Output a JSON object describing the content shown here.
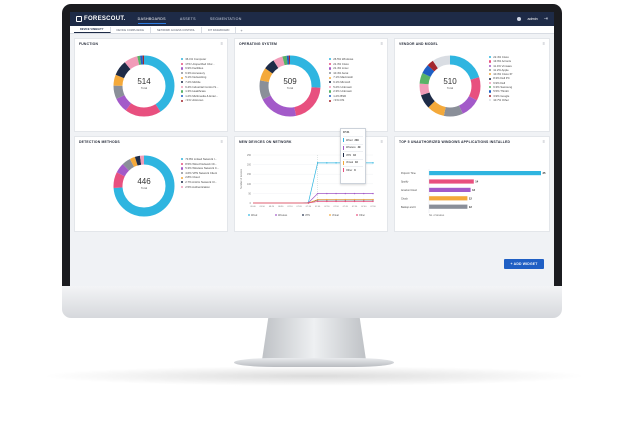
{
  "colors": {
    "cyan": "#2fb5e0",
    "pink": "#e8507f",
    "purple": "#a35ac9",
    "grey": "#8a8f99",
    "orange": "#f4a93a",
    "navy": "#1e2b47",
    "lightpink": "#f19bb8",
    "green": "#58b367",
    "blue": "#1f5fc4",
    "darkred": "#a3262e"
  },
  "topbar": {
    "logo": "FORESCOUT.",
    "nav": [
      "DASHBOARDS",
      "ASSETS",
      "SEGMENTATION"
    ],
    "user": "admin"
  },
  "tabs": [
    "DEVICE VISIBILITY",
    "DEVICE COMPLIANCE",
    "NETWORK ACCESS CONTROL",
    "IOT DASHBOARD"
  ],
  "tab_add": "+",
  "function": {
    "title": "FUNCTION",
    "total": "514",
    "total_label": "Total",
    "slices": [
      {
        "label": "36.1% Computer",
        "value": 36.1,
        "color": "#2fb5e0"
      },
      {
        "label": "17% Unspecified Infor...",
        "value": 17,
        "color": "#e8507f"
      },
      {
        "label": "6.9% Facilities",
        "value": 6.9,
        "color": "#a35ac9"
      },
      {
        "label": "6.3% Accessory",
        "value": 6.3,
        "color": "#8a8f99"
      },
      {
        "label": "5.1% Networking",
        "value": 5.1,
        "color": "#f4a93a"
      },
      {
        "label": "7.2% Mobile",
        "value": 7.2,
        "color": "#1e2b47"
      },
      {
        "label": "6.4% Industrial Control S...",
        "value": 6.4,
        "color": "#f19bb8"
      },
      {
        "label": "1.3% Healthcare",
        "value": 1.3,
        "color": "#58b367"
      },
      {
        "label": "1.2% Multimedia & Enter...",
        "value": 1.2,
        "color": "#1f5fc4"
      },
      {
        "label": "<1% Unknown",
        "value": 0.8,
        "color": "#a3262e"
      }
    ]
  },
  "os": {
    "title": "OPERATING SYSTEM",
    "total": "509",
    "total_label": "Total",
    "slices": [
      {
        "label": "26.5% Windows",
        "value": 26.5,
        "color": "#2fb5e0"
      },
      {
        "label": "21.3% Cisco",
        "value": 21.3,
        "color": "#e8507f"
      },
      {
        "label": "21.4% Linux",
        "value": 21.4,
        "color": "#a35ac9"
      },
      {
        "label": "10.4% Aurai",
        "value": 10.4,
        "color": "#8a8f99"
      },
      {
        "label": "7.1% Macintosh",
        "value": 7.1,
        "color": "#f4a93a"
      },
      {
        "label": "6.1% Microsft",
        "value": 6.1,
        "color": "#1e2b47"
      },
      {
        "label": "5.2% Unknown",
        "value": 5.2,
        "color": "#f19bb8"
      },
      {
        "label": "2.3% Unknown",
        "value": 2.3,
        "color": "#58b367"
      },
      {
        "label": "1.2% BSD",
        "value": 1.2,
        "color": "#1f5fc4"
      },
      {
        "label": "<1% iOS",
        "value": 0.8,
        "color": "#a3262e"
      }
    ]
  },
  "vendor": {
    "title": "VENDOR AND MODEL",
    "total": "510",
    "total_label": "Total",
    "slices": [
      {
        "label": "22.4% Cisco",
        "value": 22.4,
        "color": "#2fb5e0"
      },
      {
        "label": "13.9% Acronis",
        "value": 13.9,
        "color": "#e8507f"
      },
      {
        "label": "11.4% Vmware",
        "value": 11.4,
        "color": "#a35ac9"
      },
      {
        "label": "11.2% Apple",
        "value": 11.2,
        "color": "#8a8f99"
      },
      {
        "label": "10.3% Cisco IP",
        "value": 10.3,
        "color": "#f4a93a"
      },
      {
        "label": "8.3% Dell PC",
        "value": 8.3,
        "color": "#1e2b47"
      },
      {
        "label": "6.9% Dell",
        "value": 6.9,
        "color": "#f19bb8"
      },
      {
        "label": "6.3% Samsung",
        "value": 6.3,
        "color": "#58b367"
      },
      {
        "label": "5.5% Thinkit",
        "value": 5.5,
        "color": "#1f5fc4"
      },
      {
        "label": "3.9% Google",
        "value": 3.9,
        "color": "#a3262e"
      },
      {
        "label": "10.7% Other",
        "value": 10.7,
        "color": "#d9dde3"
      }
    ]
  },
  "detection": {
    "title": "DETECTION METHODS",
    "total": "446",
    "total_label": "Total",
    "slices": [
      {
        "label": "73.8% Linked Network I...",
        "value": 73.8,
        "color": "#2fb5e0"
      },
      {
        "label": "8.5% Wired Network Cli...",
        "value": 8.5,
        "color": "#e8507f"
      },
      {
        "label": "5.3% Wireless Network C...",
        "value": 5.3,
        "color": "#a35ac9"
      },
      {
        "label": "4.6% VPN Network Client",
        "value": 4.6,
        "color": "#8a8f99"
      },
      {
        "label": "2.8% Cloud",
        "value": 2.8,
        "color": "#f4a93a"
      },
      {
        "label": "2.7% Antrim Network Cl...",
        "value": 2.7,
        "color": "#1e2b47"
      },
      {
        "label": "2.5% Authentication",
        "value": 2.3,
        "color": "#f19bb8"
      }
    ]
  },
  "new_devices": {
    "title": "NEW DEVICES ON NETWORK",
    "ylabel": "Number of devices",
    "yticks": [
      "250",
      "200",
      "150",
      "100",
      "50",
      "0"
    ],
    "xticks": [
      "09:40",
      "09:50",
      "08:20",
      "08:30",
      "07:10",
      "07:20",
      "07:30",
      "07:40",
      "07:50",
      "07:10",
      "07:20",
      "07:30",
      "07:40",
      "07:50"
    ],
    "legend": [
      "Wired",
      "Wireless",
      "VPN",
      "Virtual",
      "Other"
    ],
    "tooltip": {
      "time": "07:21",
      "rows": [
        {
          "name": "Wired",
          "value": "209",
          "color": "#2fb5e0"
        },
        {
          "name": "Wireless",
          "value": "49",
          "color": "#a35ac9"
        },
        {
          "name": "VPN",
          "value": "16",
          "color": "#1e2b47"
        },
        {
          "name": "Virtual",
          "value": "18",
          "color": "#f4a93a"
        },
        {
          "name": "Other",
          "value": "8",
          "color": "#e8507f"
        }
      ]
    }
  },
  "top5": {
    "title": "TOP 5 UNAUTHORIZED WINDOWS APPLICATIONS INSTALLED",
    "xlabel": "No. of devices",
    "bars": [
      {
        "label": "Popcorn Time",
        "value": 35,
        "color": "#2fb5e0"
      },
      {
        "label": "Spotify",
        "value": 14,
        "color": "#e8507f"
      },
      {
        "label": "Amazon Cloud",
        "value": 13,
        "color": "#a35ac9"
      },
      {
        "label": "Chuck",
        "value": 12,
        "color": "#f4a93a"
      },
      {
        "label": "Backup and C",
        "value": 12,
        "color": "#8a8f99"
      }
    ]
  },
  "add_widget": "+ ADD WIDGET",
  "chart_data": [
    {
      "type": "pie",
      "title": "FUNCTION",
      "categories": [
        "Computer",
        "Unspecified Infor...",
        "Facilities",
        "Accessory",
        "Networking",
        "Mobile",
        "Industrial Control S...",
        "Healthcare",
        "Multimedia & Enter...",
        "Unknown"
      ],
      "values": [
        36.1,
        17,
        6.9,
        6.3,
        5.1,
        7.2,
        6.4,
        1.3,
        1.2,
        0.8
      ]
    },
    {
      "type": "pie",
      "title": "OPERATING SYSTEM",
      "categories": [
        "Windows",
        "Cisco",
        "Linux",
        "Aurai",
        "Macintosh",
        "Microsft",
        "Unknown",
        "Unknown",
        "BSD",
        "iOS"
      ],
      "values": [
        26.5,
        21.3,
        21.4,
        10.4,
        7.1,
        6.1,
        5.2,
        2.3,
        1.2,
        0.8
      ]
    },
    {
      "type": "pie",
      "title": "VENDOR AND MODEL",
      "categories": [
        "Cisco",
        "Acronis",
        "Vmware",
        "Apple",
        "Cisco IP",
        "Dell PC",
        "Dell",
        "Samsung",
        "Thinkit",
        "Google",
        "Other"
      ],
      "values": [
        22.4,
        13.9,
        11.4,
        11.2,
        10.3,
        8.3,
        6.9,
        6.3,
        5.5,
        3.9,
        10.7
      ]
    },
    {
      "type": "pie",
      "title": "DETECTION METHODS",
      "categories": [
        "Linked Network I...",
        "Wired Network Cli...",
        "Wireless Network C...",
        "VPN Network Client",
        "Cloud",
        "Antrim Network Cl...",
        "Authentication"
      ],
      "values": [
        73.8,
        8.5,
        5.3,
        4.6,
        2.8,
        2.7,
        2.3
      ]
    },
    {
      "type": "line",
      "title": "NEW DEVICES ON NETWORK",
      "ylabel": "Number of devices",
      "ylim": [
        0,
        250
      ],
      "x": [
        0,
        1,
        2,
        3,
        4,
        5,
        6,
        7,
        8,
        9,
        10,
        11,
        12,
        13
      ],
      "series": [
        {
          "name": "Wired",
          "values": [
            0,
            0,
            0,
            0,
            0,
            0,
            2,
            209,
            209,
            209,
            209,
            209,
            209,
            209
          ]
        },
        {
          "name": "Wireless",
          "values": [
            0,
            0,
            0,
            0,
            0,
            0,
            1,
            49,
            49,
            49,
            49,
            49,
            49,
            49
          ]
        },
        {
          "name": "VPN",
          "values": [
            0,
            0,
            0,
            0,
            0,
            0,
            0,
            16,
            16,
            16,
            16,
            16,
            16,
            16
          ]
        },
        {
          "name": "Virtual",
          "values": [
            0,
            0,
            0,
            0,
            0,
            0,
            0,
            18,
            18,
            18,
            18,
            18,
            18,
            18
          ]
        },
        {
          "name": "Other",
          "values": [
            0,
            0,
            0,
            0,
            0,
            0,
            0,
            8,
            8,
            8,
            8,
            8,
            8,
            8
          ]
        }
      ]
    },
    {
      "type": "bar",
      "title": "TOP 5 UNAUTHORIZED WINDOWS APPLICATIONS INSTALLED",
      "orientation": "horizontal",
      "categories": [
        "Popcorn Time",
        "Spotify",
        "Amazon Cloud",
        "Chuck",
        "Backup and C"
      ],
      "values": [
        35,
        14,
        13,
        12,
        12
      ],
      "xlabel": "No. of devices",
      "xlim": [
        0,
        35
      ]
    }
  ]
}
